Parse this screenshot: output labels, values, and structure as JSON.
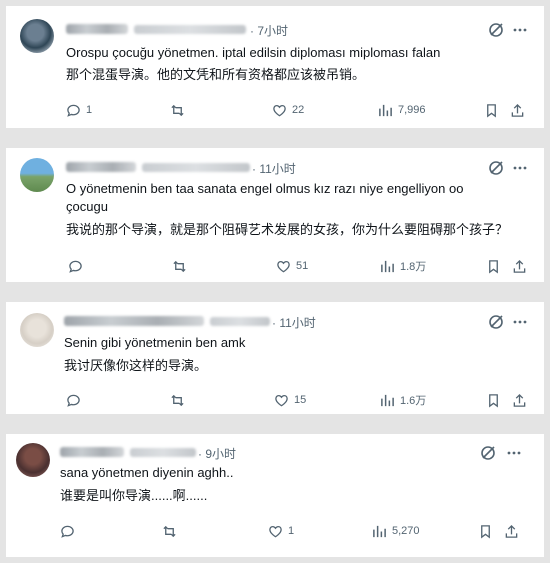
{
  "comments": [
    {
      "time": "· 7小时",
      "lines": [
        "Orospu çocuğu yönetmen. iptal edilsin diploması miploması falan",
        "那个混蛋导演。他的文凭和所有资格都应该被吊销。"
      ],
      "replies": "1",
      "likes": "22",
      "views": "7,996"
    },
    {
      "time": "· 11小时",
      "lines": [
        "O yönetmenin ben taa sanata engel olmus kız razı niye engelliyon oo",
        "çocugu",
        "我说的那个导演，就是那个阻碍艺术发展的女孩，你为什么要阻碍那个孩子？"
      ],
      "replies": "",
      "likes": "51",
      "views": "1.8万"
    },
    {
      "time": "· 11小时",
      "lines": [
        "Senin gibi yönetmenin ben amk",
        "我讨厌像你这样的导演。"
      ],
      "replies": "",
      "likes": "15",
      "views": "1.6万"
    },
    {
      "time": "· 9小时",
      "lines": [
        "sana yönetmen diyenin aghh..",
        "谁要是叫你导演......啊......"
      ],
      "replies": "",
      "likes": "1",
      "views": "5,270"
    }
  ],
  "icons": [
    "grok-icon",
    "more-icon",
    "reply-icon",
    "retweet-icon",
    "like-icon",
    "views-icon",
    "bookmark-icon",
    "share-icon"
  ],
  "colors": {
    "secondary_text": "#536471",
    "primary_text": "#0f1419",
    "background": "#e4e4e4"
  }
}
